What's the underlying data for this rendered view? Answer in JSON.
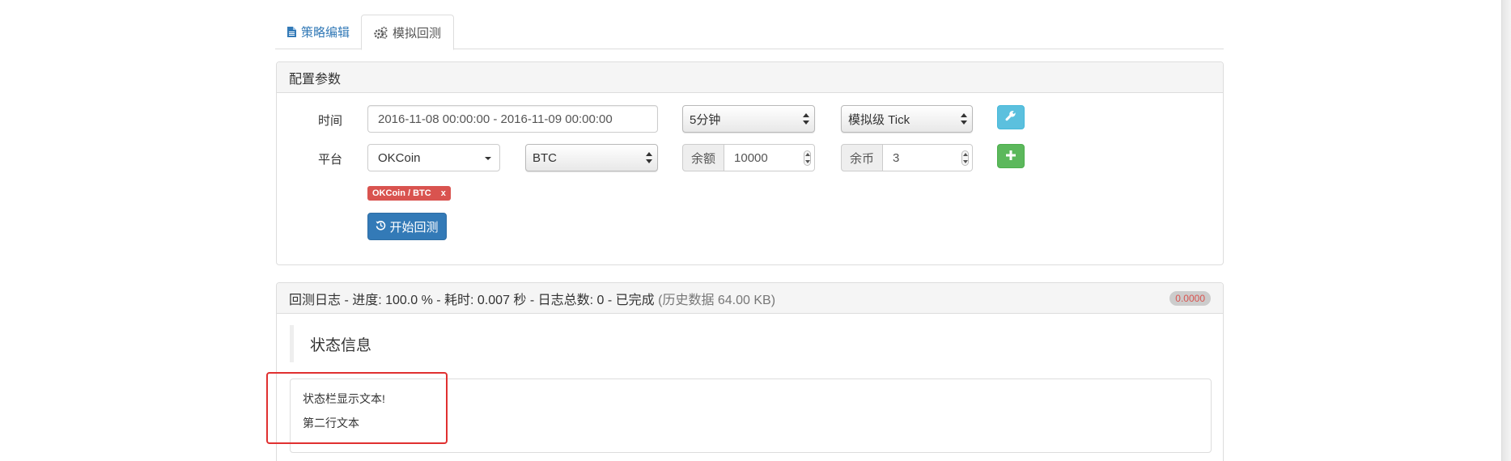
{
  "tabs": [
    {
      "label": "策略编辑",
      "icon": "document-icon"
    },
    {
      "label": "模拟回测",
      "icon": "cogs-icon"
    }
  ],
  "config": {
    "heading": "配置参数",
    "time_label": "时间",
    "time_range": "2016-11-08 00:00:00 - 2016-11-09 00:00:00",
    "period_select": "5分钟",
    "mode_select": "模拟级 Tick",
    "platform_label": "平台",
    "exchange_dropdown": "OKCoin",
    "currency_select": "BTC",
    "balance_label": "余额",
    "balance_value": "10000",
    "coins_label": "余币",
    "coins_value": "3",
    "tag_label": "OKCoin / BTC",
    "tag_remove": "x",
    "start_button": "开始回测",
    "settings_button_icon": "wrench-icon",
    "add_button_icon": "plus-icon",
    "start_button_icon": "history-icon"
  },
  "log": {
    "heading_main": "回测日志 - 进度: 100.0 % - 耗时: 0.007 秒 - 日志总数: 0 - 已完成",
    "heading_sub": "(历史数据 64.00 KB)",
    "badge": "0.0000",
    "status_title": "状态信息",
    "status_lines": [
      "状态栏显示文本!",
      "第二行文本"
    ]
  },
  "colors": {
    "primary": "#337ab7",
    "info": "#5bc0de",
    "success": "#5cb85c",
    "danger": "#d9534f",
    "highlight": "#e03030"
  }
}
